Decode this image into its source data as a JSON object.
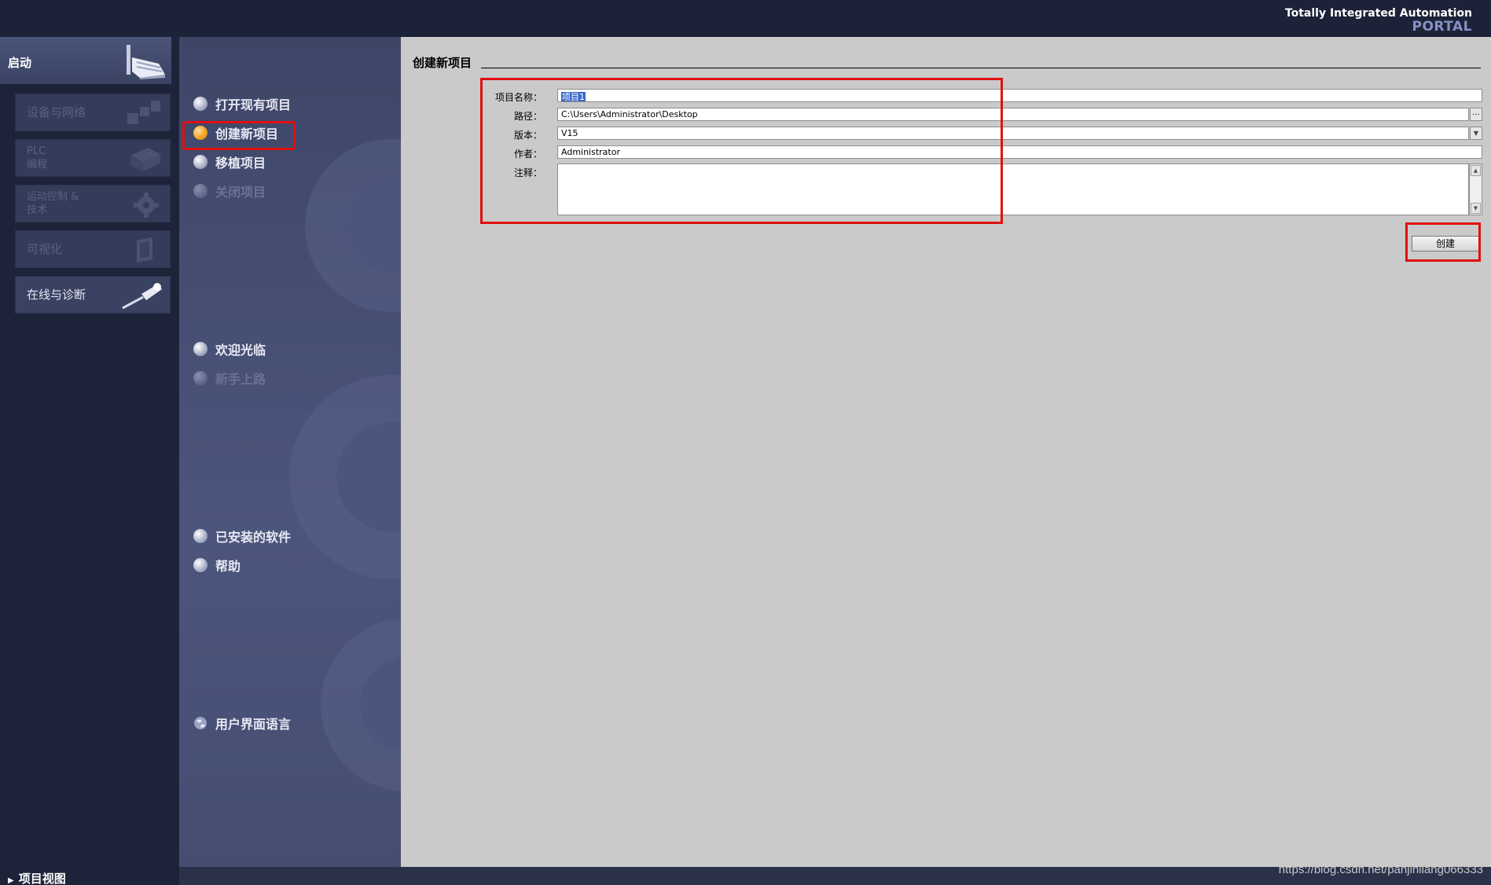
{
  "header": {
    "brand_line1": "Totally Integrated Automation",
    "brand_line2": "PORTAL"
  },
  "sidebar": {
    "start_label": "启动",
    "items": [
      {
        "label": "设备与网络",
        "enabled": false,
        "icon": "devices-network-icon"
      },
      {
        "label": "PLC\n编程",
        "enabled": false,
        "icon": "plc-programming-icon"
      },
      {
        "label": "运动控制 &\n技术",
        "enabled": false,
        "icon": "gear-icon"
      },
      {
        "label": "可视化",
        "enabled": false,
        "icon": "visualization-icon"
      },
      {
        "label": "在线与诊断",
        "enabled": true,
        "icon": "diagnostic-probe-icon"
      }
    ],
    "project_view": "项目视图"
  },
  "nav": {
    "open_project": "打开现有项目",
    "create_project": "创建新项目",
    "migrate_project": "移植项目",
    "close_project": "关闭项目",
    "welcome": "欢迎光临",
    "first_steps": "新手上路",
    "installed_software": "已安装的软件",
    "help": "帮助",
    "ui_language": "用户界面语言"
  },
  "main": {
    "section_title": "创建新项目",
    "form": {
      "project_name_label": "项目名称：",
      "project_name_value": "项目1",
      "path_label": "路径：",
      "path_value": "C:\\Users\\Administrator\\Desktop",
      "version_label": "版本：",
      "version_value": "V15",
      "author_label": "作者：",
      "author_value": "Administrator",
      "comment_label": "注释：",
      "comment_value": ""
    },
    "browse_label": "...",
    "create_button": "创建"
  },
  "watermark": "https://blog.csdn.net/panjinliang066333",
  "colors": {
    "highlight": "#e01010",
    "active_radio": "#f5a623",
    "main_bg": "#cacaca",
    "brand_accent": "#8591c4"
  }
}
